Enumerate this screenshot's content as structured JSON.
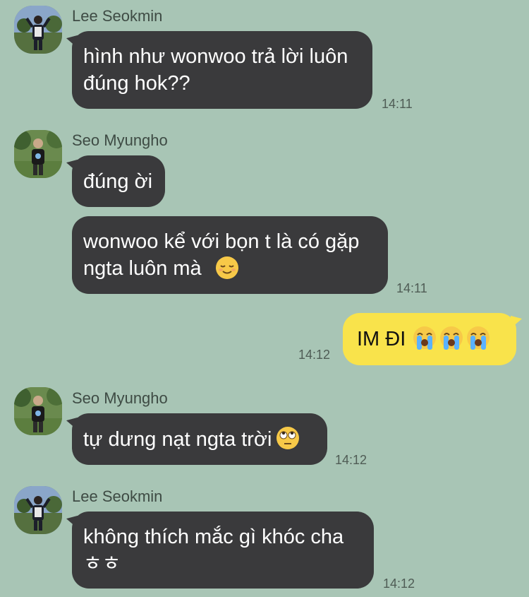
{
  "messages": [
    {
      "sender": "Lee Seokmin",
      "text": "hình như wonwoo trả lời luôn\nđúng hok??",
      "time": "14:11"
    },
    {
      "sender": "Seo Myungho",
      "text": "đúng ời"
    },
    {
      "text": "wonwoo kể với bọn t là có gặp\nngta luôn mà",
      "emoji": "relieved-face",
      "time": "14:11"
    },
    {
      "text": "IM ĐI",
      "emoji": "loudly-crying-face",
      "emoji_count": 3,
      "time": "14:12",
      "outgoing": true
    },
    {
      "sender": "Seo Myungho",
      "text": "tự dưng nạt ngta trời",
      "emoji": "face-with-rolling-eyes",
      "time": "14:12"
    },
    {
      "sender": "Lee Seokmin",
      "text": "không thích mắc gì khóc cha\nㅎㅎ",
      "time": "14:12"
    }
  ],
  "colors": {
    "background": "#a8c5b5",
    "incoming_bubble": "#3a3a3c",
    "outgoing_bubble": "#f9e34b"
  }
}
